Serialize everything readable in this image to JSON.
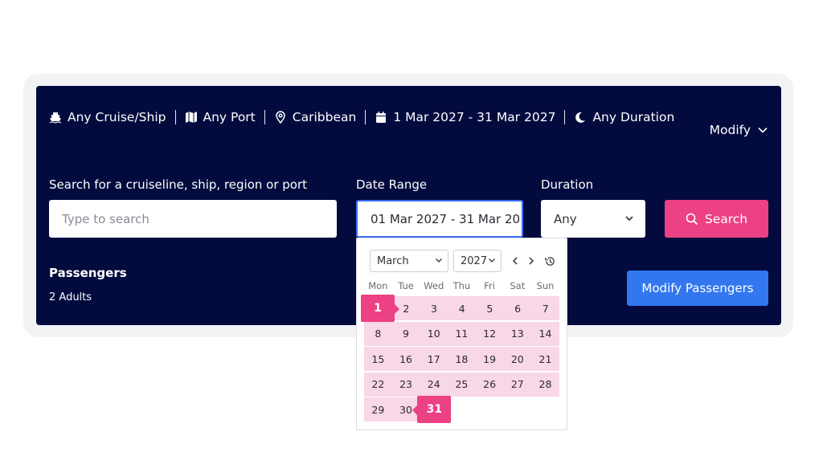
{
  "summary": {
    "ship": "Any Cruise/Ship",
    "port": "Any Port",
    "region": "Caribbean",
    "dates": "1 Mar 2027 - 31 Mar 2027",
    "duration": "Any Duration"
  },
  "modify_label": "Modify",
  "search": {
    "label": "Search for a cruiseline, ship, region or port",
    "placeholder": "Type to search"
  },
  "date_range": {
    "label": "Date Range",
    "value": "01 Mar 2027 - 31 Mar 20"
  },
  "duration": {
    "label": "Duration",
    "value": "Any"
  },
  "search_button": "Search",
  "passengers": {
    "title": "Passengers",
    "value": "2 Adults",
    "button": "Modify Passengers"
  },
  "calendar": {
    "month": "March",
    "year": "2027",
    "weekdays": [
      "Mon",
      "Tue",
      "Wed",
      "Thu",
      "Fri",
      "Sat",
      "Sun"
    ],
    "weeks": [
      [
        "1",
        "2",
        "3",
        "4",
        "5",
        "6",
        "7"
      ],
      [
        "8",
        "9",
        "10",
        "11",
        "12",
        "13",
        "14"
      ],
      [
        "15",
        "16",
        "17",
        "18",
        "19",
        "20",
        "21"
      ],
      [
        "22",
        "23",
        "24",
        "25",
        "26",
        "27",
        "28"
      ],
      [
        "29",
        "30",
        "31",
        "",
        "",
        "",
        ""
      ]
    ],
    "range_start": "1",
    "range_end": "31"
  },
  "colors": {
    "panel": "#030b3e",
    "accent_pink": "#ec4183",
    "range_fill": "#f8d7e7",
    "button_blue": "#3277f0"
  },
  "icons": [
    "ship-icon",
    "map-icon",
    "location-pin-icon",
    "calendar-icon",
    "moon-icon",
    "chevron-down-icon",
    "search-icon",
    "chevron-left-icon",
    "chevron-right-icon",
    "history-icon"
  ]
}
